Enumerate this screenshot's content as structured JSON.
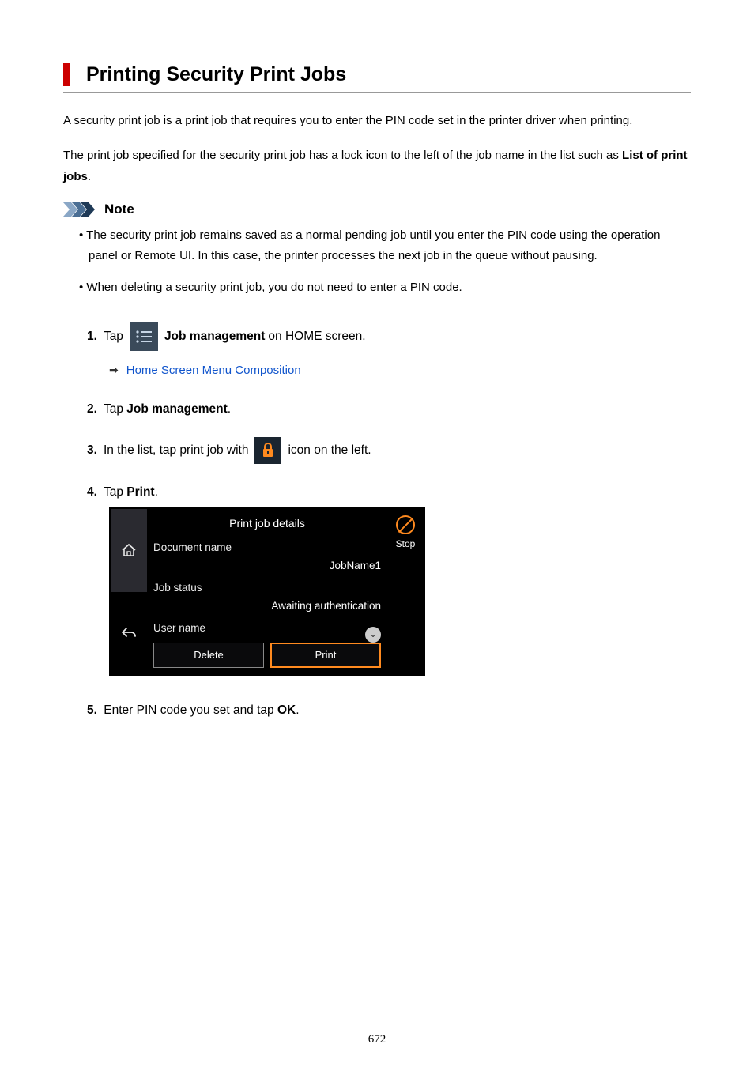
{
  "title": "Printing Security Print Jobs",
  "intro1": "A security print job is a print job that requires you to enter the PIN code set in the printer driver when printing.",
  "intro2_a": "The print job specified for the security print job has a lock icon to the left of the job name in the list such as ",
  "intro2_b": "List of print jobs",
  "intro2_c": ".",
  "note_label": "Note",
  "notes": [
    "The security print job remains saved as a normal pending job until you enter the PIN code using the operation panel or Remote UI. In this case, the printer processes the next job in the queue without pausing.",
    "When deleting a security print job, you do not need to enter a PIN code."
  ],
  "steps": {
    "s1": {
      "num": "1.",
      "a": "Tap",
      "b": "Job management",
      "c": " on HOME screen."
    },
    "sublink": "Home Screen Menu Composition",
    "s2": {
      "num": "2.",
      "a": "Tap ",
      "b": "Job management",
      "c": "."
    },
    "s3": {
      "num": "3.",
      "a": "In the list, tap print job with",
      "c": "icon on the left."
    },
    "s4": {
      "num": "4.",
      "a": "Tap ",
      "b": "Print",
      "c": "."
    },
    "s5": {
      "num": "5.",
      "a": "Enter PIN code you set and tap ",
      "b": "OK",
      "c": "."
    }
  },
  "chart_data": {
    "type": "table",
    "title": "Print job details",
    "rows": [
      {
        "label": "Document name",
        "value": "JobName1"
      },
      {
        "label": "Job status",
        "value": "Awaiting authentication"
      },
      {
        "label": "User name",
        "value": ""
      }
    ],
    "buttons": {
      "delete": "Delete",
      "print": "Print"
    },
    "right": {
      "label": "Stop"
    }
  },
  "page_number": "672"
}
